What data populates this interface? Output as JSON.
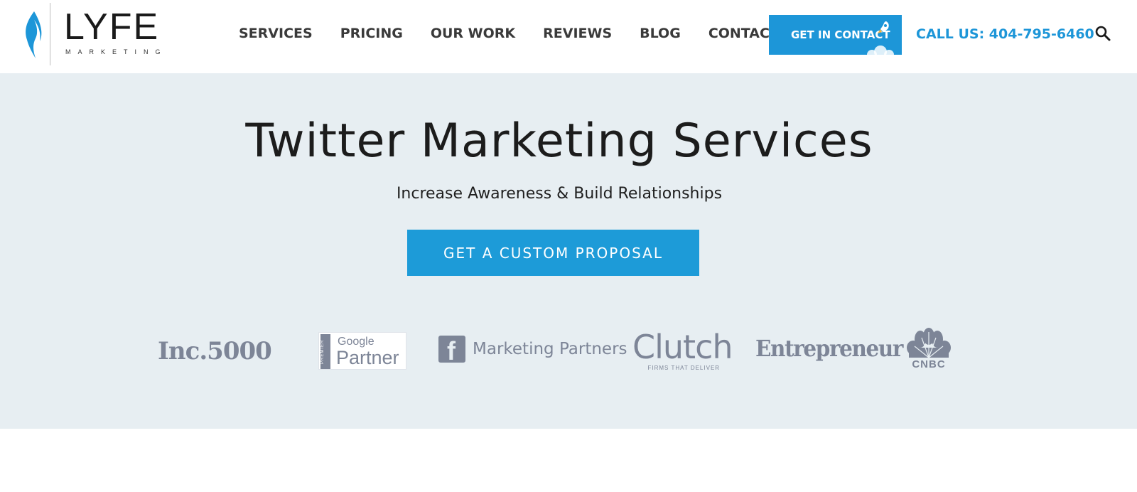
{
  "header": {
    "logo": {
      "word": "LYFE",
      "sub": "MARKETING"
    },
    "nav": [
      "SERVICES",
      "PRICING",
      "OUR WORK",
      "REVIEWS",
      "BLOG",
      "CONTACT"
    ],
    "contact_button": "GET IN CONTACT",
    "phone": "CALL US: 404-795-6460"
  },
  "hero": {
    "title": "Twitter Marketing Services",
    "subtitle": "Increase Awareness & Build Relationships",
    "cta": "GET A CUSTOM PROPOSAL"
  },
  "partners": {
    "inc": "Inc.5000",
    "google_small": "Google",
    "google_big": "Partner",
    "google_badge": "PREMIER",
    "facebook": "Marketing Partners",
    "clutch": "Clutch",
    "clutch_sub": "FIRMS THAT DELIVER",
    "entrepreneur": "Entrepreneur",
    "cnbc": "CNBC"
  },
  "colors": {
    "accent": "#1d96d8",
    "hero_bg": "#e7eef2",
    "logo_gray": "#7d8597"
  }
}
